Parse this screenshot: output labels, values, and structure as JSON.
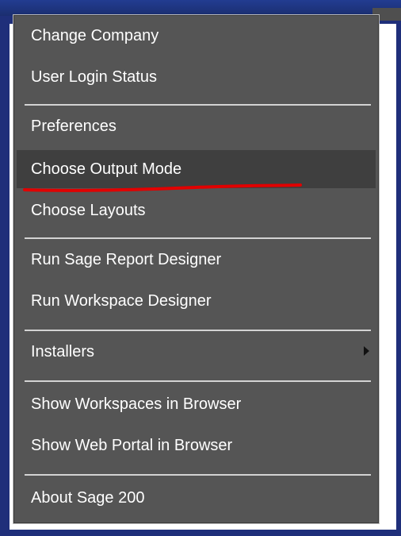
{
  "menu": {
    "items": [
      {
        "label": "Change Company"
      },
      {
        "label": "User Login Status"
      },
      {
        "label": "Preferences"
      },
      {
        "label": "Choose Output Mode"
      },
      {
        "label": "Choose Layouts"
      },
      {
        "label": "Run Sage Report Designer"
      },
      {
        "label": "Run Workspace Designer"
      },
      {
        "label": "Installers"
      },
      {
        "label": "Show Workspaces in Browser"
      },
      {
        "label": "Show Web Portal in Browser"
      },
      {
        "label": "About Sage 200"
      }
    ],
    "highlighted_item": "Choose Output Mode",
    "submenu_icon": "chevron-right-icon",
    "annotation_color": "#e10000"
  }
}
